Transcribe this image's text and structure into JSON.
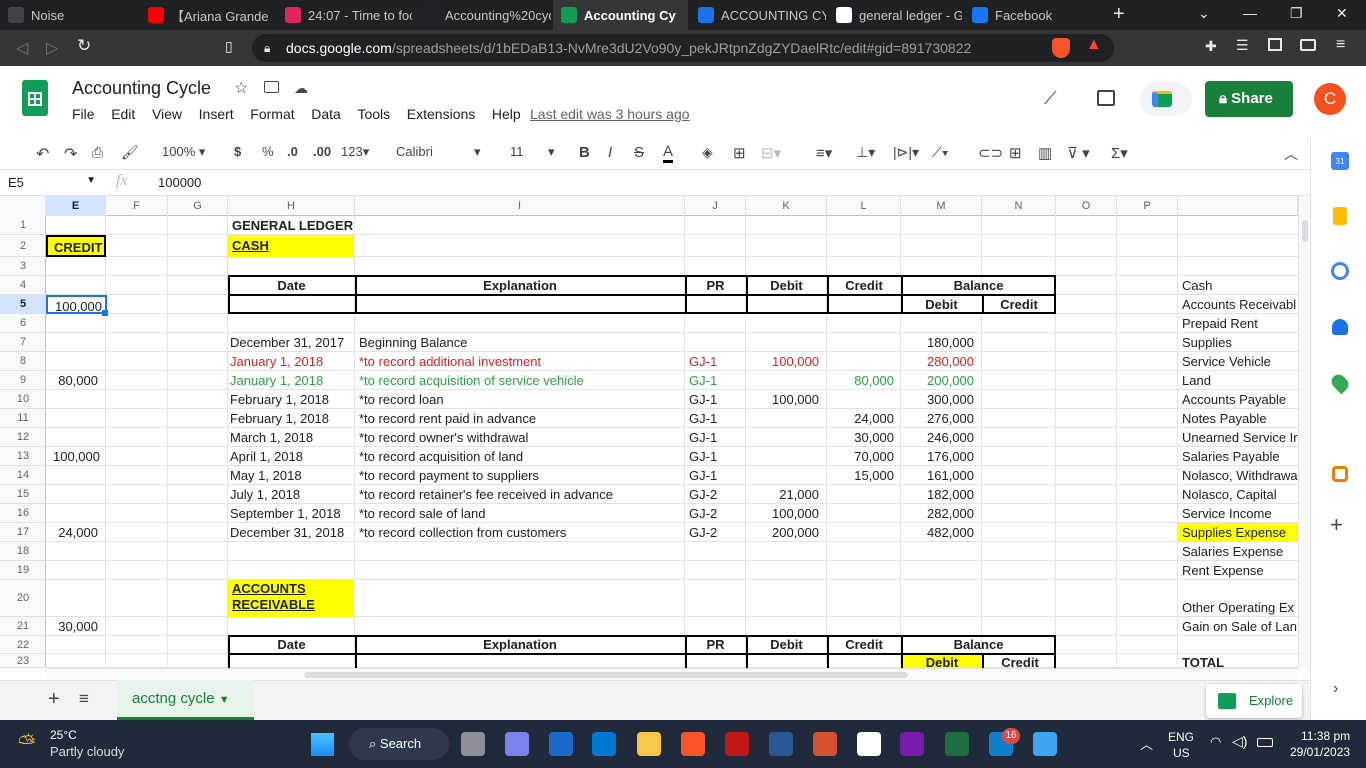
{
  "browser": {
    "tabs": [
      {
        "label": "Noise",
        "icon": "notion-icon"
      },
      {
        "label": "【Ariana Grande",
        "icon": "youtube-icon"
      },
      {
        "label": "24:07 - Time to foc",
        "icon": "timer-icon"
      },
      {
        "label": "Accounting%20cyc",
        "icon": "file-icon"
      },
      {
        "label": "Accounting Cy",
        "icon": "sheets-icon"
      },
      {
        "label": "ACCOUNTING CYC",
        "icon": "classroom-icon"
      },
      {
        "label": "general ledger - G",
        "icon": "google-icon"
      },
      {
        "label": "Facebook",
        "icon": "facebook-icon"
      }
    ],
    "url_host": "docs.google.com",
    "url_path": "/spreadsheets/d/1bEDaB13-NvMre3dU2Vo90y_pekJRtpnZdgZYDaelRtc/edit#gid=891730822"
  },
  "doc": {
    "title": "Accounting Cycle",
    "menus": [
      "File",
      "Edit",
      "View",
      "Insert",
      "Format",
      "Data",
      "Tools",
      "Extensions",
      "Help"
    ],
    "last_edit": "Last edit was 3 hours ago",
    "share": "Share",
    "avatar": "C"
  },
  "toolbar": {
    "zoom": "100%",
    "currency": "$",
    "percent": "%",
    "dec_dec": ".0",
    "dec_inc": ".00",
    "format": "123",
    "font": "Calibri",
    "size": "11"
  },
  "formula": {
    "cell_ref": "E5",
    "fx": "fx",
    "value": "100000"
  },
  "columns": [
    "E",
    "F",
    "G",
    "H",
    "I",
    "J",
    "K",
    "L",
    "M",
    "N",
    "O",
    "P"
  ],
  "rows": [
    "1",
    "2",
    "3",
    "4",
    "5",
    "6",
    "7",
    "8",
    "9",
    "10",
    "11",
    "12",
    "13",
    "14",
    "15",
    "16",
    "17",
    "18",
    "19",
    "20",
    "21",
    "22",
    "23"
  ],
  "ledger": {
    "title": "GENERAL LEDGER",
    "account1": "CASH",
    "account2_line1": "ACCOUNTS",
    "account2_line2": "RECEIVABLE",
    "h_date": "Date",
    "h_expl": "Explanation",
    "h_pr": "PR",
    "h_debit": "Debit",
    "h_credit": "Credit",
    "h_balance": "Balance",
    "h_bdebit": "Debit",
    "h_bcredit": "Credit",
    "entries": [
      {
        "date": "December 31, 2017",
        "expl": "Beginning Balance",
        "pr": "",
        "debit": "",
        "credit": "",
        "balance": "180,000",
        "color": ""
      },
      {
        "date": "January 1, 2018",
        "expl": "*to record additional investment",
        "pr": "GJ-1",
        "debit": "100,000",
        "credit": "",
        "balance": "280,000",
        "color": "red"
      },
      {
        "date": "January 1, 2018",
        "expl": "*to record acquisition of service vehicle",
        "pr": "GJ-1",
        "debit": "",
        "credit": "80,000",
        "balance": "200,000",
        "color": "green"
      },
      {
        "date": "February 1, 2018",
        "expl": "*to record loan",
        "pr": "GJ-1",
        "debit": "100,000",
        "credit": "",
        "balance": "300,000",
        "color": ""
      },
      {
        "date": "February 1, 2018",
        "expl": "*to record rent paid in advance",
        "pr": "GJ-1",
        "debit": "",
        "credit": "24,000",
        "balance": "276,000",
        "color": ""
      },
      {
        "date": "March 1, 2018",
        "expl": "*to record owner's withdrawal",
        "pr": "GJ-1",
        "debit": "",
        "credit": "30,000",
        "balance": "246,000",
        "color": ""
      },
      {
        "date": "April 1, 2018",
        "expl": "*to record acquisition of land",
        "pr": "GJ-1",
        "debit": "",
        "credit": "70,000",
        "balance": "176,000",
        "color": ""
      },
      {
        "date": "May 1, 2018",
        "expl": "*to record payment to suppliers",
        "pr": "GJ-1",
        "debit": "",
        "credit": "15,000",
        "balance": "161,000",
        "color": ""
      },
      {
        "date": "July 1, 2018",
        "expl": "*to record retainer's fee received in advance",
        "pr": "GJ-2",
        "debit": "21,000",
        "credit": "",
        "balance": "182,000",
        "color": ""
      },
      {
        "date": "September 1, 2018",
        "expl": "*to record sale of land",
        "pr": "GJ-2",
        "debit": "100,000",
        "credit": "",
        "balance": "282,000",
        "color": ""
      },
      {
        "date": "December 31, 2018",
        "expl": "*to record collection from customers",
        "pr": "GJ-2",
        "debit": "200,000",
        "credit": "",
        "balance": "482,000",
        "color": ""
      }
    ]
  },
  "col_e": {
    "header": "CREDIT",
    "r5": "100,000",
    "r9": "80,000",
    "r13": "100,000",
    "r17": "24,000",
    "r21": "30,000"
  },
  "accounts_list": [
    "Cash",
    "Accounts Receivabl",
    "Prepaid Rent",
    "Supplies",
    "Service Vehicle",
    "Land",
    "Accounts Payable",
    "Notes Payable",
    "Unearned Service Ir",
    "Salaries Payable",
    "Nolasco, Withdrawa",
    "Nolasco, Capital",
    "Service Income",
    "Supplies Expense",
    "Salaries Expense",
    "Rent Expense",
    "Other Operating Ex",
    "Gain on Sale of Lan",
    "TOTAL"
  ],
  "sheet_tab": "acctng cycle",
  "explore": "Explore",
  "taskbar": {
    "temp": "25°C",
    "weather": "Partly cloudy",
    "search": "Search",
    "lang1": "ENG",
    "lang2": "US",
    "time": "11:38 pm",
    "date": "29/01/2023",
    "badge": "16"
  }
}
